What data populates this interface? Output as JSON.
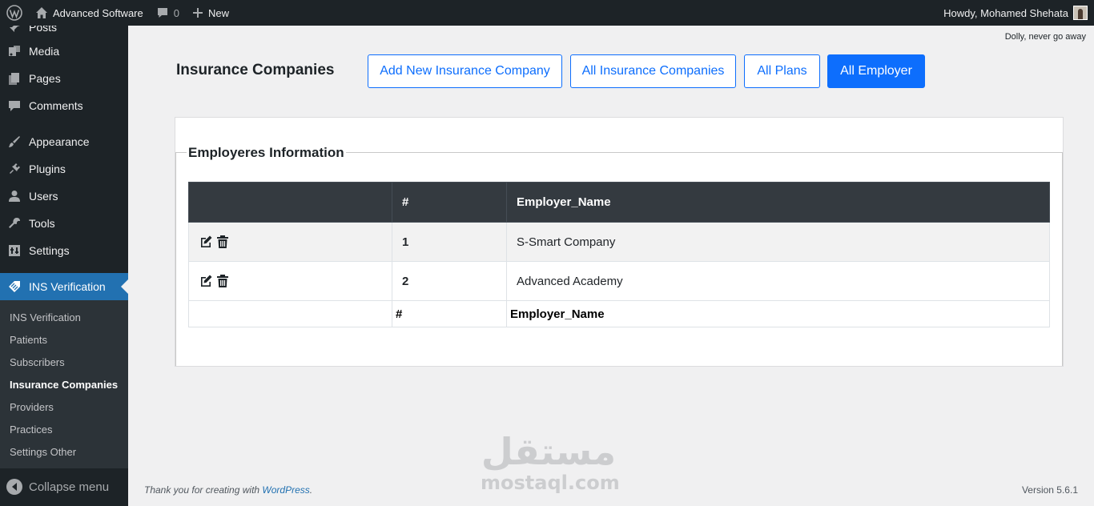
{
  "adminbar": {
    "site_name": "Advanced Software",
    "comments_count": "0",
    "new_label": "New",
    "greeting": "Howdy, Mohamed Shehata"
  },
  "sidebar": {
    "items": [
      {
        "label": "Posts",
        "icon": "pin-icon"
      },
      {
        "label": "Media",
        "icon": "media-icon"
      },
      {
        "label": "Pages",
        "icon": "pages-icon"
      },
      {
        "label": "Comments",
        "icon": "comment-icon"
      },
      {
        "label": "Appearance",
        "icon": "brush-icon"
      },
      {
        "label": "Plugins",
        "icon": "plug-icon"
      },
      {
        "label": "Users",
        "icon": "user-icon"
      },
      {
        "label": "Tools",
        "icon": "wrench-icon"
      },
      {
        "label": "Settings",
        "icon": "settings-icon"
      },
      {
        "label": "INS Verification",
        "icon": "tag-icon"
      }
    ],
    "submenu": [
      "INS Verification",
      "Patients",
      "Subscribers",
      "Insurance Companies",
      "Providers",
      "Practices",
      "Settings Other"
    ],
    "active_submenu": "Insurance Companies",
    "collapse_label": "Collapse menu"
  },
  "dolly": "Dolly, never go away",
  "page": {
    "heading": "Insurance Companies",
    "buttons": [
      "Add New Insurance Company",
      "All Insurance Companies",
      "All Plans",
      "All Employer"
    ],
    "active_button": "All Employer"
  },
  "section": {
    "legend": "Employeres Information",
    "columns": [
      "",
      "#",
      "Employer_Name"
    ],
    "rows": [
      {
        "num": "1",
        "name": "S-Smart Company"
      },
      {
        "num": "2",
        "name": "Advanced Academy"
      }
    ],
    "footer_columns": [
      "",
      "#",
      "Employer_Name"
    ]
  },
  "footer": {
    "thanks_prefix": "Thank you for creating with",
    "wordpress_link": "WordPress",
    "thanks_suffix": ".",
    "version": "Version 5.6.1"
  },
  "watermark": {
    "arabic": "مستقل",
    "latin": "mostaql.com"
  },
  "colors": {
    "admin_dark": "#1d2327",
    "accent_blue": "#2271b1",
    "primary_button": "#0d6efd",
    "table_header": "#343a40"
  }
}
